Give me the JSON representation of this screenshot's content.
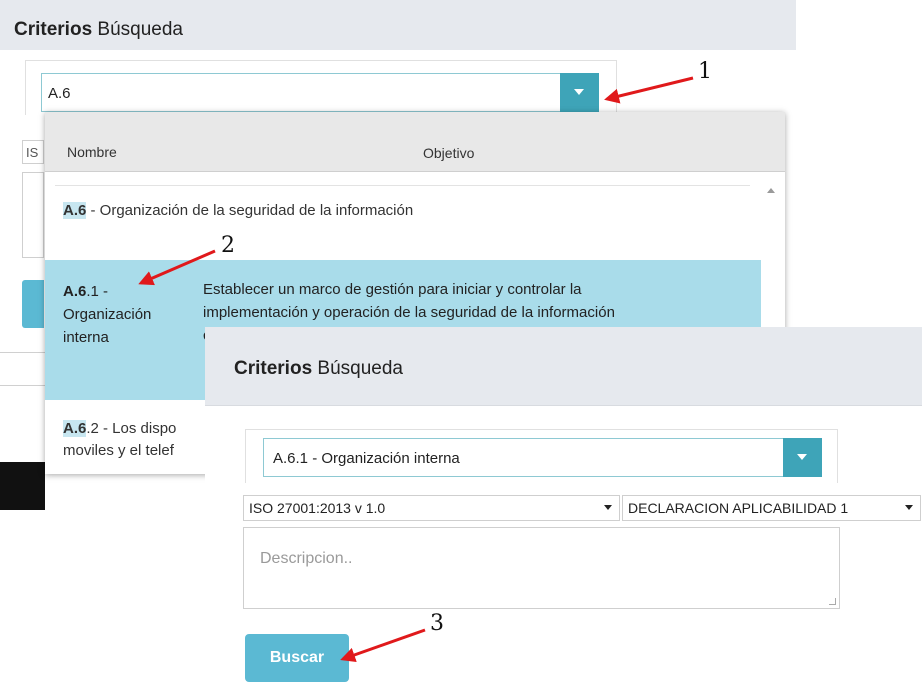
{
  "panel1": {
    "title_bold": "Criterios",
    "title_rest": " Búsqueda",
    "combo_value": "A.6",
    "select_stub_text": "IS",
    "dropdown": {
      "col_name": "Nombre",
      "col_objective": "Objetivo",
      "row1": {
        "code": "A.6",
        "text": " - Organización de la seguridad de la información"
      },
      "row2": {
        "code": "A.6",
        "name_rest": ".1 -",
        "name_line2": "Organización",
        "name_line3": "interna",
        "objective_line1": "Establecer un marco de gestión para iniciar y controlar la",
        "objective_line2": "implementación y operación de la seguridad de la información",
        "objective_line3": "c"
      },
      "row3": {
        "code": "A.6",
        "text_line1": ".2 - Los dispo",
        "text_line2": "moviles y el telef"
      }
    }
  },
  "panel2": {
    "title_bold": "Criterios",
    "title_rest": " Búsqueda",
    "combo_value": "A.6.1 - Organización interna",
    "select1": "ISO 27001:2013 v 1.0",
    "select2": "DECLARACION APLICABILIDAD 1",
    "textarea_placeholder": "Descripcion..",
    "search_button": "Buscar"
  },
  "annotations": {
    "step1": "1",
    "step2": "2",
    "step3": "3",
    "arrow_color": "#e0191b"
  },
  "colors": {
    "accent": "#3ea4b8",
    "button": "#5bb9d3",
    "highlight": "#a9dcea",
    "header_bg": "#e6e9ee"
  }
}
